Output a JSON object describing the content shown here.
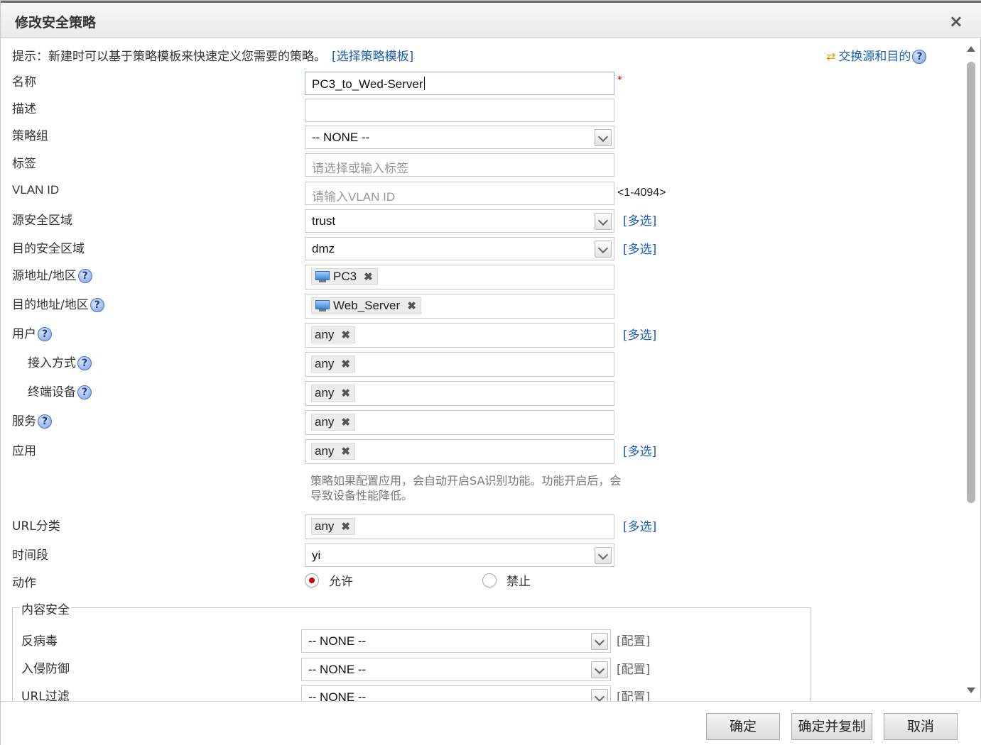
{
  "dialog": {
    "title": "修改安全策略",
    "close": "×"
  },
  "hint": {
    "text": "提示：新建时可以基于策略模板来快速定义您需要的策略。",
    "link": "[选择策略模板]"
  },
  "swap": {
    "label": "交换源和目的",
    "icon": "swap-arrows-icon"
  },
  "fields": {
    "name": {
      "label": "名称",
      "value": "PC3_to_Wed-Server",
      "required": "*"
    },
    "description": {
      "label": "描述",
      "value": ""
    },
    "policy_group": {
      "label": "策略组",
      "value": "-- NONE --"
    },
    "tag": {
      "label": "标签",
      "placeholder": "请选择或输入标签"
    },
    "vlan_id": {
      "label": "VLAN ID",
      "placeholder": "请输入VLAN ID",
      "range": "<1-4094>"
    },
    "src_zone": {
      "label": "源安全区域",
      "value": "trust",
      "link": "[多选]"
    },
    "dst_zone": {
      "label": "目的安全区域",
      "value": "dmz",
      "link": "[多选]"
    },
    "src_addr": {
      "label": "源地址/地区",
      "tag": "PC3"
    },
    "dst_addr": {
      "label": "目的地址/地区",
      "tag": "Web_Server"
    },
    "user": {
      "label": "用户",
      "tag": "any",
      "link": "[多选]"
    },
    "access_mode": {
      "label": "接入方式",
      "tag": "any"
    },
    "terminal": {
      "label": "终端设备",
      "tag": "any"
    },
    "service": {
      "label": "服务",
      "tag": "any"
    },
    "application": {
      "label": "应用",
      "tag": "any",
      "link": "[多选]",
      "note": "策略如果配置应用，会自动开启SA识别功能。功能开启后，会导致设备性能降低。"
    },
    "url_category": {
      "label": "URL分类",
      "tag": "any",
      "link": "[多选]"
    },
    "time_range": {
      "label": "时间段",
      "value": "yi"
    },
    "action": {
      "label": "动作",
      "options": [
        "允许",
        "禁止"
      ],
      "selected": "允许"
    }
  },
  "content_security": {
    "legend": "内容安全",
    "rows": [
      {
        "label": "反病毒",
        "value": "-- NONE --",
        "link": "[配置]"
      },
      {
        "label": "入侵防御",
        "value": "-- NONE --",
        "link": "[配置]"
      },
      {
        "label": "URL过滤",
        "value": "-- NONE --",
        "link": "[配置]"
      }
    ]
  },
  "help_icon": "?",
  "tag_remove": "✖",
  "buttons": {
    "ok": "确定",
    "ok_copy": "确定并复制",
    "cancel": "取消"
  },
  "colors": {
    "link": "#1a5fb4",
    "required": "#dd0000",
    "radio_on": "#cc0000"
  }
}
